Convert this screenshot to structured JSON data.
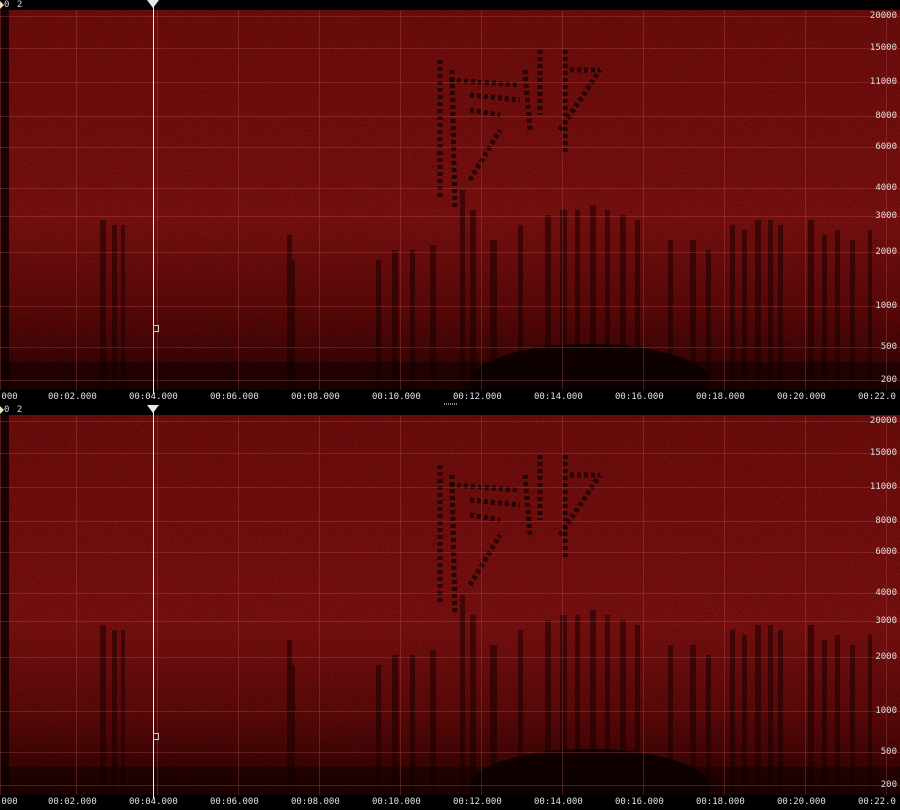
{
  "colors": {
    "spectrogram_base": "#7a0f0f",
    "spectrogram_dark": "#140000",
    "grid": "#c86060",
    "axis_bg": "#000000",
    "label": "#e0e0e0",
    "playhead": "#f2f2f2"
  },
  "panes": [
    {
      "channel_label": "0 2",
      "frequency_labels": [
        "20000",
        "15000",
        "11000",
        "8000",
        "6000",
        "4000",
        "3000",
        "2000",
        "1000",
        "500",
        "200"
      ],
      "time_labels": [
        ".000",
        "00:02.000",
        "00:04.000",
        "00:06.000",
        "00:08.000",
        "00:10.000",
        "00:12.000",
        "00:14.000",
        "00:16.000",
        "00:18.000",
        "00:20.000",
        "00:22.0"
      ]
    },
    {
      "channel_label": "0 2",
      "frequency_labels": [
        "20000",
        "15000",
        "11000",
        "8000",
        "6000",
        "4000",
        "3000",
        "2000",
        "1000",
        "500",
        "200"
      ],
      "time_labels": [
        ".000",
        "00:02.000",
        "00:04.000",
        "00:06.000",
        "00:08.000",
        "00:10.000",
        "00:12.000",
        "00:14.000",
        "00:16.000",
        "00:18.000",
        "00:20.000",
        "00:22.0"
      ]
    }
  ]
}
